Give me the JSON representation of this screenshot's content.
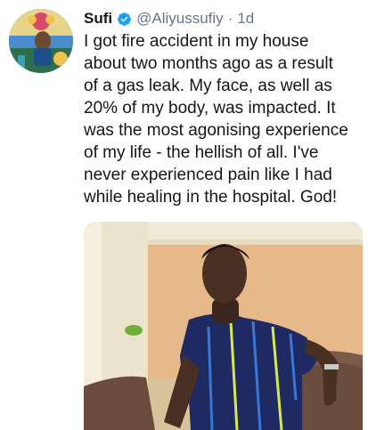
{
  "tweet": {
    "author_name": "Sufi",
    "handle": "@Aliyussufiy",
    "separator": "·",
    "timestamp": "1d",
    "text_lines": [
      "I got fire accident in my house",
      "about two months ago as a result",
      "of a gas leak. My face, as well as",
      "20% of my body, was impacted. It",
      "was the most agonising experience",
      "of my life - the hellish of all. I've",
      "never experienced pain like I had",
      "while healing in the hospital. God!"
    ]
  },
  "icons": {
    "verified": "verified-badge-icon"
  },
  "colors": {
    "text": "#14171a",
    "secondary": "#657786",
    "verified": "#1da1f2"
  }
}
